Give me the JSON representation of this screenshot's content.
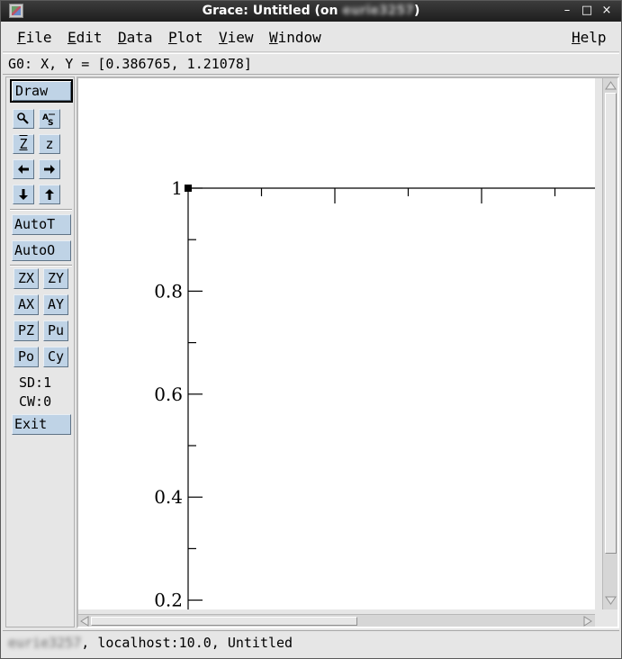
{
  "window": {
    "title_prefix": "Grace: Untitled (on ",
    "title_host": "eurie3257",
    "title_suffix": ")",
    "minimize": "–",
    "maximize": "□",
    "close": "×"
  },
  "menubar": {
    "file": "File",
    "edit": "Edit",
    "data": "Data",
    "plot": "Plot",
    "view": "View",
    "window": "Window",
    "help": "Help"
  },
  "locator": "G0: X, Y = [0.386765, 1.21078]",
  "toolbar": {
    "draw": "Draw",
    "zoom_in": "Z",
    "zoom_out": "z",
    "autot": "AutoT",
    "autoo": "AutoO",
    "zx": "ZX",
    "zy": "ZY",
    "ax": "AX",
    "ay": "AY",
    "pz": "PZ",
    "pu": "Pu",
    "po": "Po",
    "cy": "Cy",
    "sd": "SD:1",
    "cw": "CW:0",
    "exit": "Exit",
    "icons": [
      "magnifier-icon",
      "autoscale-text-icon",
      "arrow-left-icon",
      "arrow-right-icon",
      "arrow-down-icon",
      "arrow-up-icon"
    ]
  },
  "chart_data": {
    "type": "line",
    "series": [],
    "yticks": [
      "1",
      "0.8",
      "0.6",
      "0.4",
      "0.2"
    ],
    "ytick_values": [
      1,
      0.8,
      0.6,
      0.4,
      0.2
    ],
    "grid": false
  },
  "statusbar": {
    "host": "eurie3257",
    "rest": ", localhost:10.0, Untitled"
  },
  "colors": {
    "button_face": "#bfd3e6",
    "titlebar": "#2a2a2a",
    "canvas": "#ffffff"
  }
}
